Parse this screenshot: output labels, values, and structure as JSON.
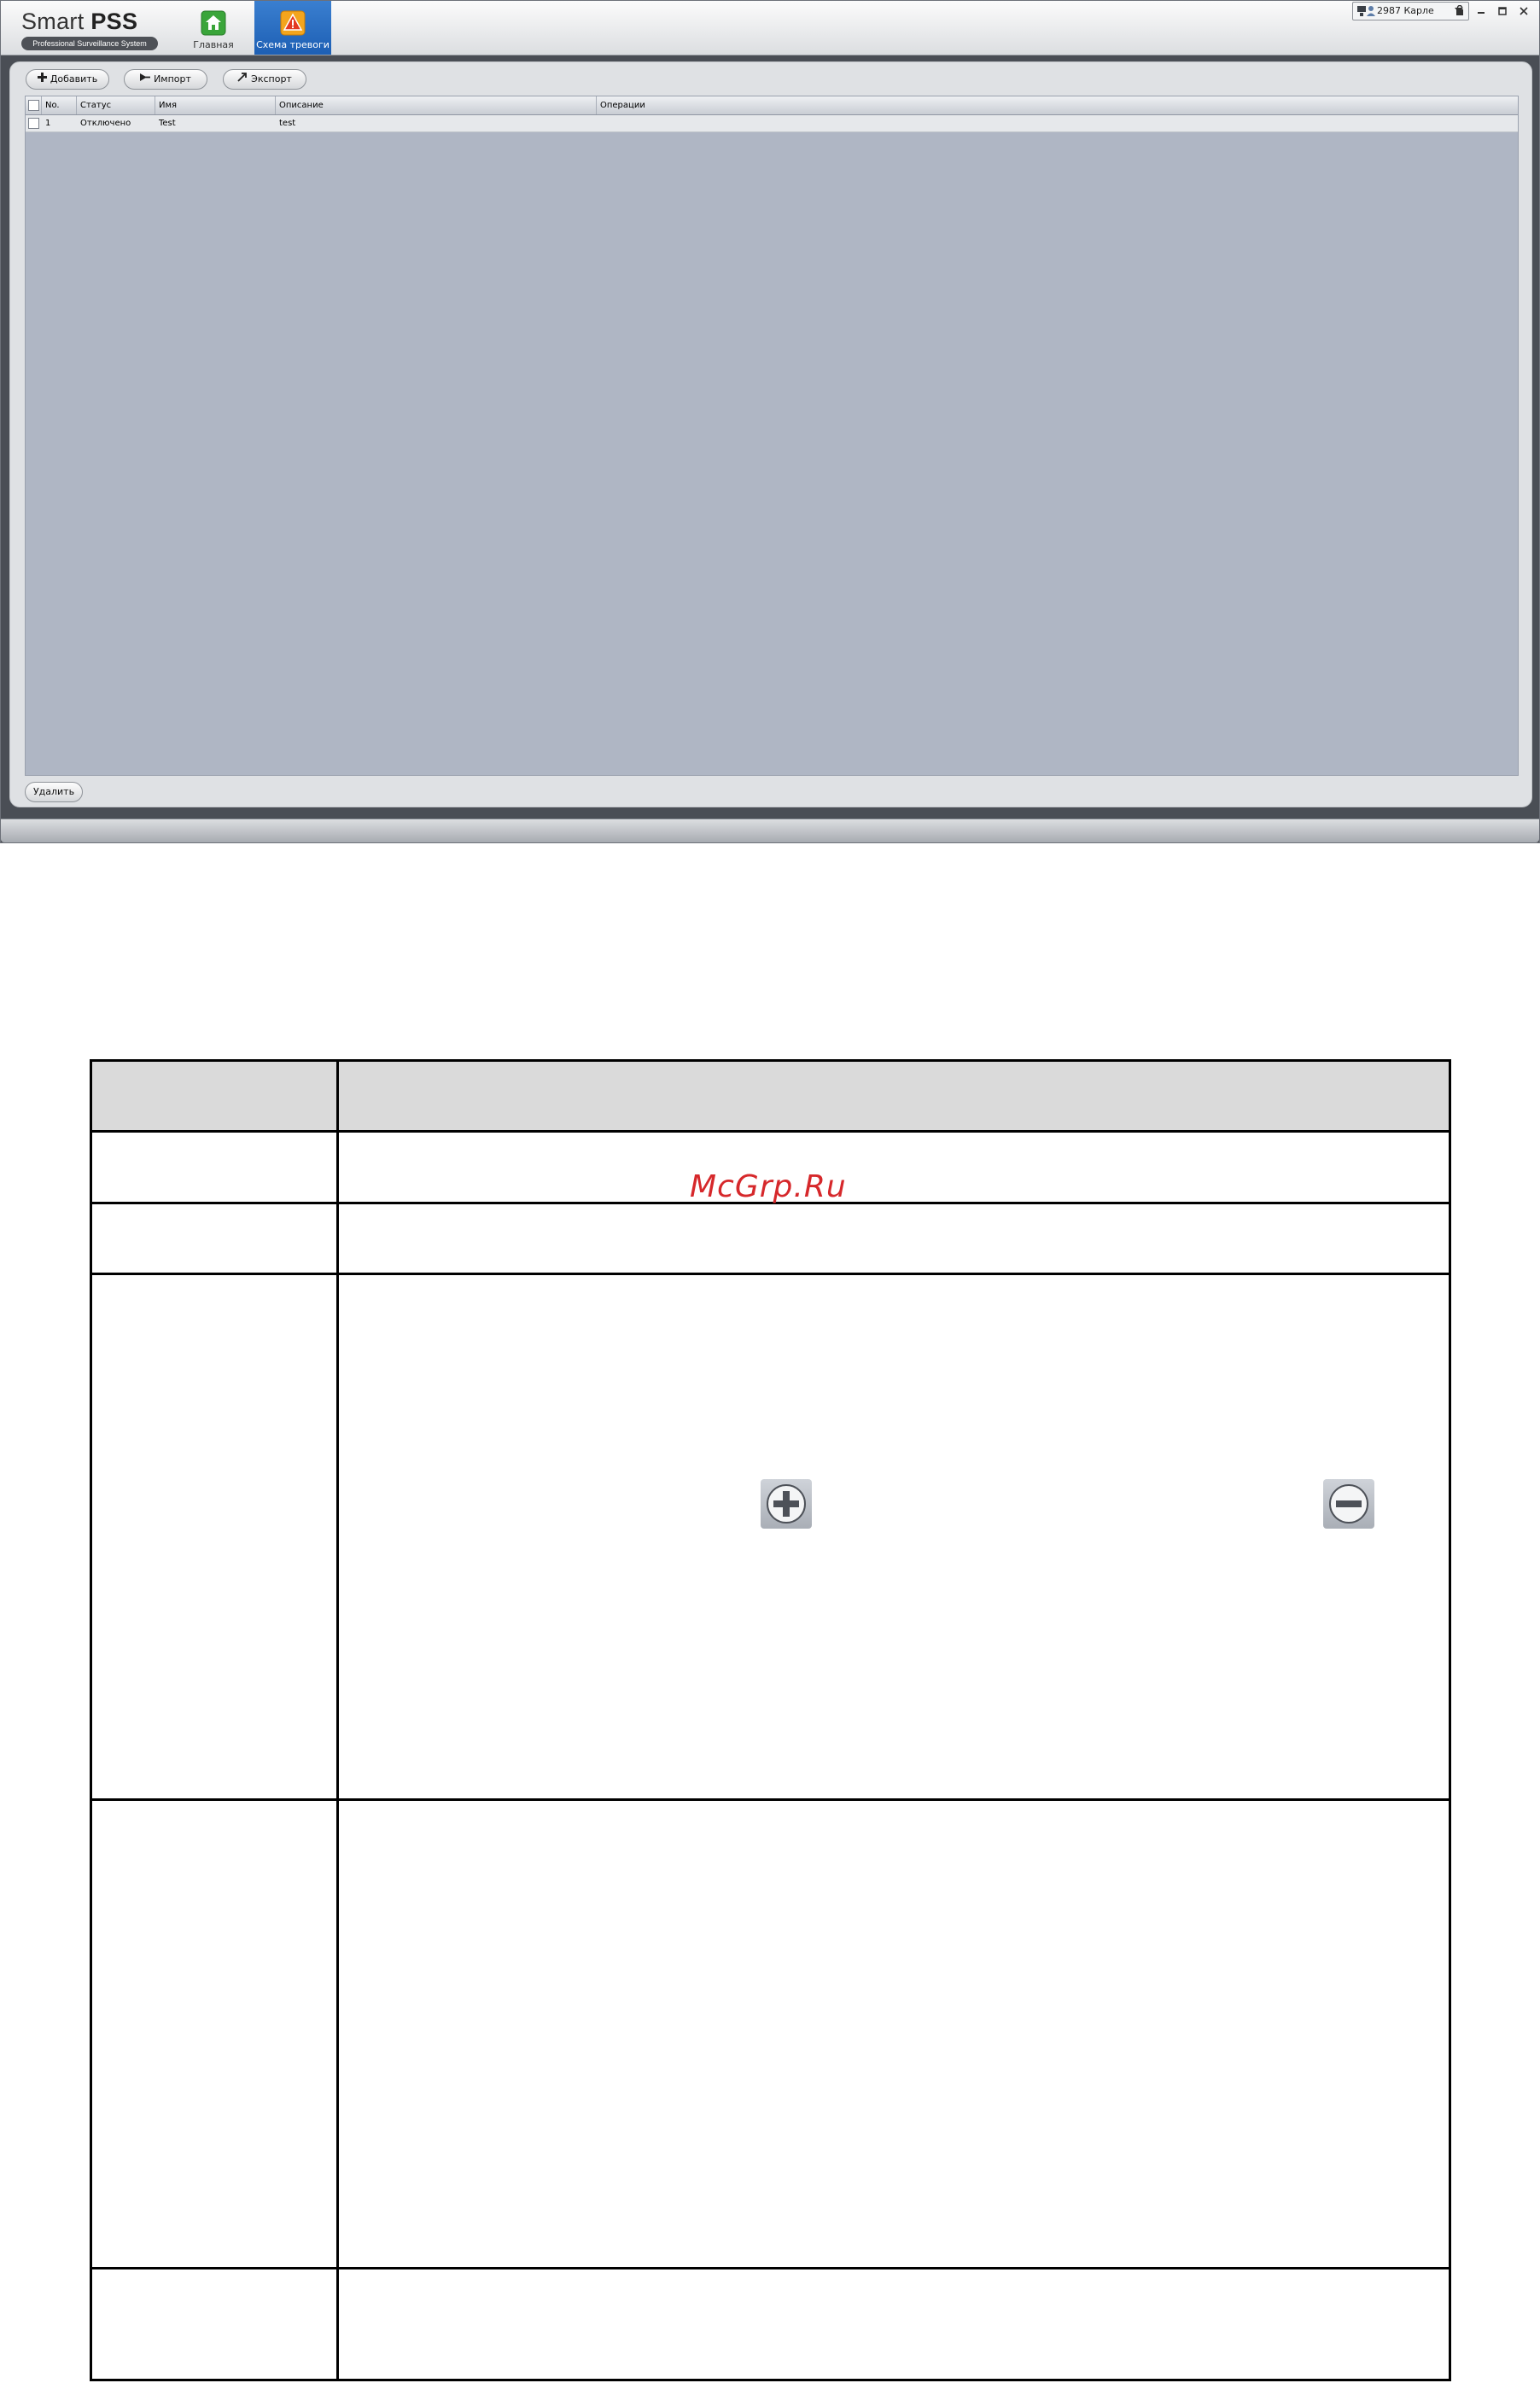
{
  "app": {
    "brand_name_light": "Smart",
    "brand_name_bold": "PSS",
    "brand_tagline": "Professional Surveillance System",
    "nav_tabs": [
      {
        "label": "Главная",
        "icon": "home-icon"
      },
      {
        "label": "Схема тревоги",
        "icon": "alarm-scheme-icon"
      }
    ],
    "tray_text": "2987 Карле",
    "window_controls": [
      "minimize-icon",
      "maximize-icon",
      "close-icon"
    ]
  },
  "toolbar": {
    "add_label": "Добавить",
    "import_label": "Импорт",
    "export_label": "Экспорт"
  },
  "grid": {
    "columns": [
      "No.",
      "Статус",
      "Имя",
      "Описание",
      "Операции"
    ],
    "rows": [
      {
        "no": "1",
        "status": "Отключено",
        "name": "Test",
        "description": "test",
        "operations": ""
      }
    ]
  },
  "footer": {
    "delete_label": "Удалить"
  },
  "document": {
    "watermark": "McGrp.Ru",
    "icons": [
      "add-circle-icon",
      "remove-circle-icon"
    ]
  },
  "colors": {
    "active_tab": "#1d5fb4",
    "grid_background": "#afb6c4",
    "watermark": "#d6282b"
  }
}
